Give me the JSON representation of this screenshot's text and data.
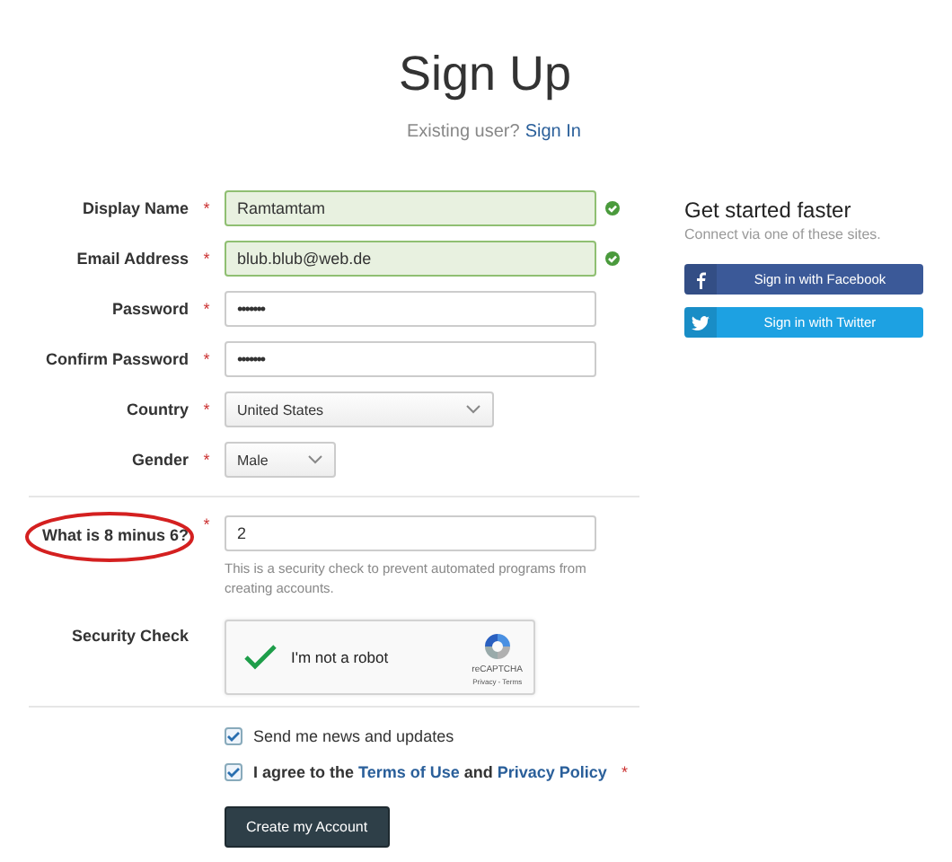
{
  "title": "Sign Up",
  "signin_prompt": {
    "text": "Existing user?",
    "link": "Sign In"
  },
  "fields": [
    {
      "label": "Display Name",
      "required_mark": "*",
      "kind": "text",
      "value": "Ramtamtam",
      "valid": true
    },
    {
      "label": "Email Address",
      "required_mark": "*",
      "kind": "text",
      "value": "blub.blub@web.de",
      "valid": true
    },
    {
      "label": "Password",
      "required_mark": "*",
      "kind": "password",
      "value": "•••••••",
      "valid": false
    },
    {
      "label": "Confirm Password",
      "required_mark": "*",
      "kind": "password",
      "value": "•••••••",
      "valid": false
    },
    {
      "label": "Country",
      "required_mark": "*",
      "kind": "select",
      "value": "United States"
    },
    {
      "label": "Gender",
      "required_mark": "*",
      "kind": "select-small",
      "value": "Male"
    }
  ],
  "question": {
    "label": "What is 8 minus 6?",
    "required_mark": "*",
    "value": "2",
    "help": "This is a security check to prevent automated programs from creating accounts.",
    "highlighted": true
  },
  "captcha": {
    "label": "Security Check",
    "text": "I'm not a robot",
    "checked": true,
    "brand": "reCAPTCHA",
    "links": "Privacy - Terms"
  },
  "options": [
    {
      "kind": "plain",
      "text": "Send me news and updates",
      "checked": true
    },
    {
      "kind": "terms",
      "text": "I agree to the",
      "link1": "Terms of Use",
      "joiner": "and",
      "link2": "Privacy Policy",
      "checked": true,
      "required_mark": "*"
    }
  ],
  "submit": "Create my Account",
  "social": {
    "title": "Get started faster",
    "subtitle": "Connect via one of these sites.",
    "buttons": [
      {
        "kind": "facebook",
        "label": "Sign in with Facebook",
        "color": "#3b5998"
      },
      {
        "kind": "twitter",
        "label": "Sign in with Twitter",
        "color": "#1da1e2"
      }
    ]
  }
}
